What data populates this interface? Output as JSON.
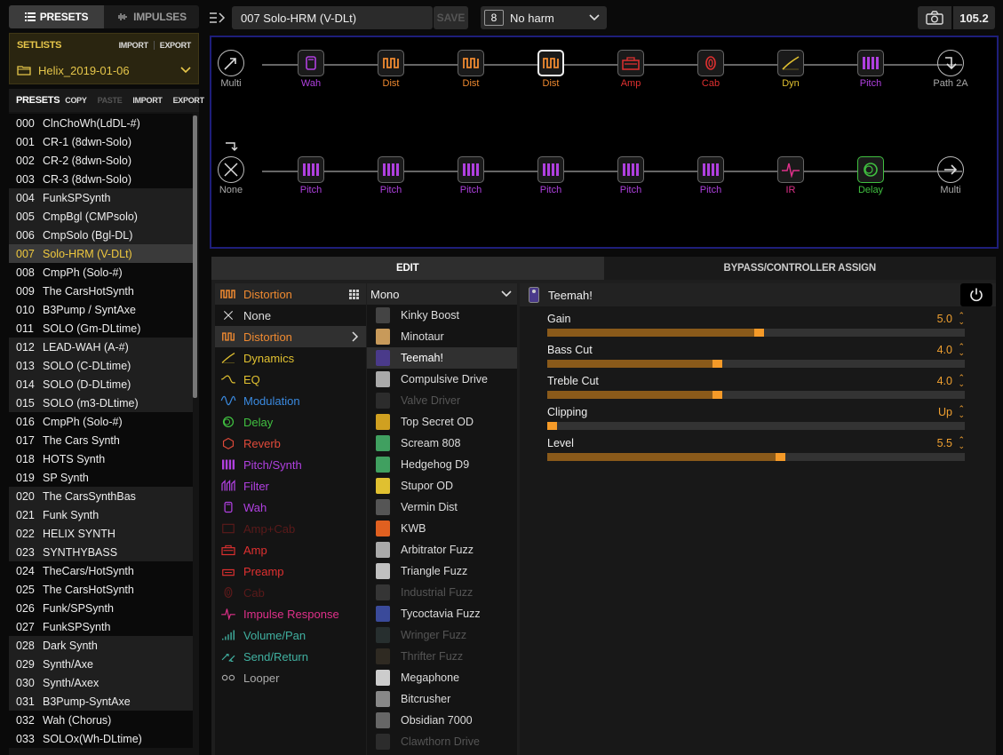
{
  "tabs": {
    "presets": "PRESETS",
    "impulses": "IMPULSES"
  },
  "setlists": {
    "title": "SETLISTS",
    "import": "IMPORT",
    "export": "EXPORT",
    "current": "Helix_2019-01-06"
  },
  "presets_panel": {
    "title": "PRESETS",
    "copy": "COPY",
    "paste": "PASTE",
    "import": "IMPORT",
    "export": "EXPORT",
    "items": [
      {
        "num": "000",
        "name": "ClnChoWh(LdDL-#)"
      },
      {
        "num": "001",
        "name": "CR-1 (8dwn-Solo)"
      },
      {
        "num": "002",
        "name": "CR-2 (8dwn-Solo)"
      },
      {
        "num": "003",
        "name": "CR-3 (8dwn-Solo)"
      },
      {
        "num": "004",
        "name": "FunkSPSynth"
      },
      {
        "num": "005",
        "name": "CmpBgl (CMPsolo)"
      },
      {
        "num": "006",
        "name": "CmpSolo (Bgl-DL)"
      },
      {
        "num": "007",
        "name": "Solo-HRM (V-DLt)"
      },
      {
        "num": "008",
        "name": "CmpPh (Solo-#)"
      },
      {
        "num": "009",
        "name": "The CarsHotSynth"
      },
      {
        "num": "010",
        "name": "B3Pump / SyntAxe"
      },
      {
        "num": "011",
        "name": "SOLO (Gm-DLtime)"
      },
      {
        "num": "012",
        "name": "LEAD-WAH (A-#)"
      },
      {
        "num": "013",
        "name": "SOLO (C-DLtime)"
      },
      {
        "num": "014",
        "name": "SOLO (D-DLtime)"
      },
      {
        "num": "015",
        "name": "SOLO (m3-DLtime)"
      },
      {
        "num": "016",
        "name": "CmpPh (Solo-#)"
      },
      {
        "num": "017",
        "name": "The Cars Synth"
      },
      {
        "num": "018",
        "name": "HOTS Synth"
      },
      {
        "num": "019",
        "name": "SP Synth"
      },
      {
        "num": "020",
        "name": "The CarsSynthBas"
      },
      {
        "num": "021",
        "name": "Funk Synth"
      },
      {
        "num": "022",
        "name": "HELIX SYNTH"
      },
      {
        "num": "023",
        "name": "SYNTHYBASS"
      },
      {
        "num": "024",
        "name": "TheCars/HotSynth"
      },
      {
        "num": "025",
        "name": "The CarsHotSynth"
      },
      {
        "num": "026",
        "name": "Funk/SPSynth"
      },
      {
        "num": "027",
        "name": "FunkSPSynth"
      },
      {
        "num": "028",
        "name": "Dark Synth"
      },
      {
        "num": "029",
        "name": "Synth/Axe"
      },
      {
        "num": "030",
        "name": "Synth/Axex"
      },
      {
        "num": "031",
        "name": "B3Pump-SyntAxe"
      },
      {
        "num": "032",
        "name": "Wah (Chorus)"
      },
      {
        "num": "033",
        "name": "SOLOx(Wh-DLtime)"
      }
    ]
  },
  "topbar": {
    "preset_name": "007  Solo-HRM (V-DLt)",
    "save": "SAVE",
    "snapshot_num": "8",
    "snapshot_name": "No harm",
    "tempo": "105.2"
  },
  "grid": {
    "row1": [
      {
        "label": "Multi",
        "color": "#aaaaaa",
        "icon": "split-icon"
      },
      {
        "label": "Wah",
        "color": "#b040e0",
        "icon": "wah-icon"
      },
      {
        "label": "Dist",
        "color": "#f08a30",
        "icon": "distortion-icon"
      },
      {
        "label": "Dist",
        "color": "#f08a30",
        "icon": "distortion-icon"
      },
      {
        "label": "Dist",
        "color": "#f08a30",
        "icon": "distortion-icon"
      },
      {
        "label": "Amp",
        "color": "#e03030",
        "icon": "amp-icon"
      },
      {
        "label": "Cab",
        "color": "#e03030",
        "icon": "cab-icon"
      },
      {
        "label": "Dyn",
        "color": "#e0c030",
        "icon": "dynamics-icon"
      },
      {
        "label": "Pitch",
        "color": "#b040e0",
        "icon": "pitch-icon"
      },
      {
        "label": "Path 2A",
        "color": "#aaaaaa",
        "icon": "path-down-icon"
      }
    ],
    "row2": [
      {
        "label": "None",
        "color": "#aaaaaa",
        "icon": "none-icon"
      },
      {
        "label": "Pitch",
        "color": "#b040e0",
        "icon": "pitch-icon"
      },
      {
        "label": "Pitch",
        "color": "#b040e0",
        "icon": "pitch-icon"
      },
      {
        "label": "Pitch",
        "color": "#b040e0",
        "icon": "pitch-icon"
      },
      {
        "label": "Pitch",
        "color": "#b040e0",
        "icon": "pitch-icon"
      },
      {
        "label": "Pitch",
        "color": "#b040e0",
        "icon": "pitch-icon"
      },
      {
        "label": "Pitch",
        "color": "#b040e0",
        "icon": "pitch-icon"
      },
      {
        "label": "IR",
        "color": "#e0308a",
        "icon": "ir-icon"
      },
      {
        "label": "Delay",
        "color": "#40c040",
        "icon": "delay-icon"
      },
      {
        "label": "Multi",
        "color": "#aaaaaa",
        "icon": "output-icon"
      }
    ]
  },
  "edit_tabs": {
    "edit": "EDIT",
    "bypass": "BYPASS/CONTROLLER ASSIGN"
  },
  "categories": {
    "header": "Distortion",
    "items": [
      {
        "label": "None",
        "color": "#dddddd"
      },
      {
        "label": "Distortion",
        "color": "#f08a30"
      },
      {
        "label": "Dynamics",
        "color": "#e0c030"
      },
      {
        "label": "EQ",
        "color": "#e0c030"
      },
      {
        "label": "Modulation",
        "color": "#3a8ae0"
      },
      {
        "label": "Delay",
        "color": "#40c040"
      },
      {
        "label": "Reverb",
        "color": "#e04a3a"
      },
      {
        "label": "Pitch/Synth",
        "color": "#b040e0"
      },
      {
        "label": "Filter",
        "color": "#b040e0"
      },
      {
        "label": "Wah",
        "color": "#b040e0"
      },
      {
        "label": "Amp+Cab",
        "color": "#5a1a1a"
      },
      {
        "label": "Amp",
        "color": "#e03030"
      },
      {
        "label": "Preamp",
        "color": "#e03030"
      },
      {
        "label": "Cab",
        "color": "#5a1a1a"
      },
      {
        "label": "Impulse Response",
        "color": "#e0308a"
      },
      {
        "label": "Volume/Pan",
        "color": "#40b0a0"
      },
      {
        "label": "Send/Return",
        "color": "#40b0a0"
      },
      {
        "label": "Looper",
        "color": "#aaaaaa"
      }
    ]
  },
  "models": {
    "header": "Mono",
    "items": [
      {
        "label": "Kinky Boost",
        "state": "normal",
        "color": "#444444"
      },
      {
        "label": "Minotaur",
        "state": "normal",
        "color": "#c89a5a"
      },
      {
        "label": "Teemah!",
        "state": "sel",
        "color": "#4a3a8a"
      },
      {
        "label": "Compulsive Drive",
        "state": "normal",
        "color": "#aaaaaa"
      },
      {
        "label": "Valve Driver",
        "state": "dim",
        "color": "#444444"
      },
      {
        "label": "Top Secret OD",
        "state": "normal",
        "color": "#d0a020"
      },
      {
        "label": "Scream 808",
        "state": "normal",
        "color": "#40a060"
      },
      {
        "label": "Hedgehog D9",
        "state": "normal",
        "color": "#40a060"
      },
      {
        "label": "Stupor OD",
        "state": "normal",
        "color": "#e0c030"
      },
      {
        "label": "Vermin Dist",
        "state": "normal",
        "color": "#555555"
      },
      {
        "label": "KWB",
        "state": "normal",
        "color": "#e06020"
      },
      {
        "label": "Arbitrator Fuzz",
        "state": "normal",
        "color": "#aaaaaa"
      },
      {
        "label": "Triangle Fuzz",
        "state": "normal",
        "color": "#c0c0c0"
      },
      {
        "label": "Industrial Fuzz",
        "state": "dim",
        "color": "#555555"
      },
      {
        "label": "Tycoctavia Fuzz",
        "state": "normal",
        "color": "#3a4a9a"
      },
      {
        "label": "Wringer Fuzz",
        "state": "dim",
        "color": "#3a4a4a"
      },
      {
        "label": "Thrifter Fuzz",
        "state": "dim",
        "color": "#4a4030"
      },
      {
        "label": "Megaphone",
        "state": "normal",
        "color": "#cccccc"
      },
      {
        "label": "Bitcrusher",
        "state": "normal",
        "color": "#888888"
      },
      {
        "label": "Obsidian 7000",
        "state": "normal",
        "color": "#666666"
      },
      {
        "label": "Clawthorn Drive",
        "state": "dim",
        "color": "#444444"
      }
    ]
  },
  "param_panel": {
    "title": "Teemah!",
    "params": [
      {
        "name": "Gain",
        "value": "5.0",
        "level": 0.5
      },
      {
        "name": "Bass Cut",
        "value": "4.0",
        "level": 0.4
      },
      {
        "name": "Treble Cut",
        "value": "4.0",
        "level": 0.4
      },
      {
        "name": "Clipping",
        "value": "Up",
        "level": 0.0
      },
      {
        "name": "Level",
        "value": "5.5",
        "level": 0.55
      }
    ]
  }
}
